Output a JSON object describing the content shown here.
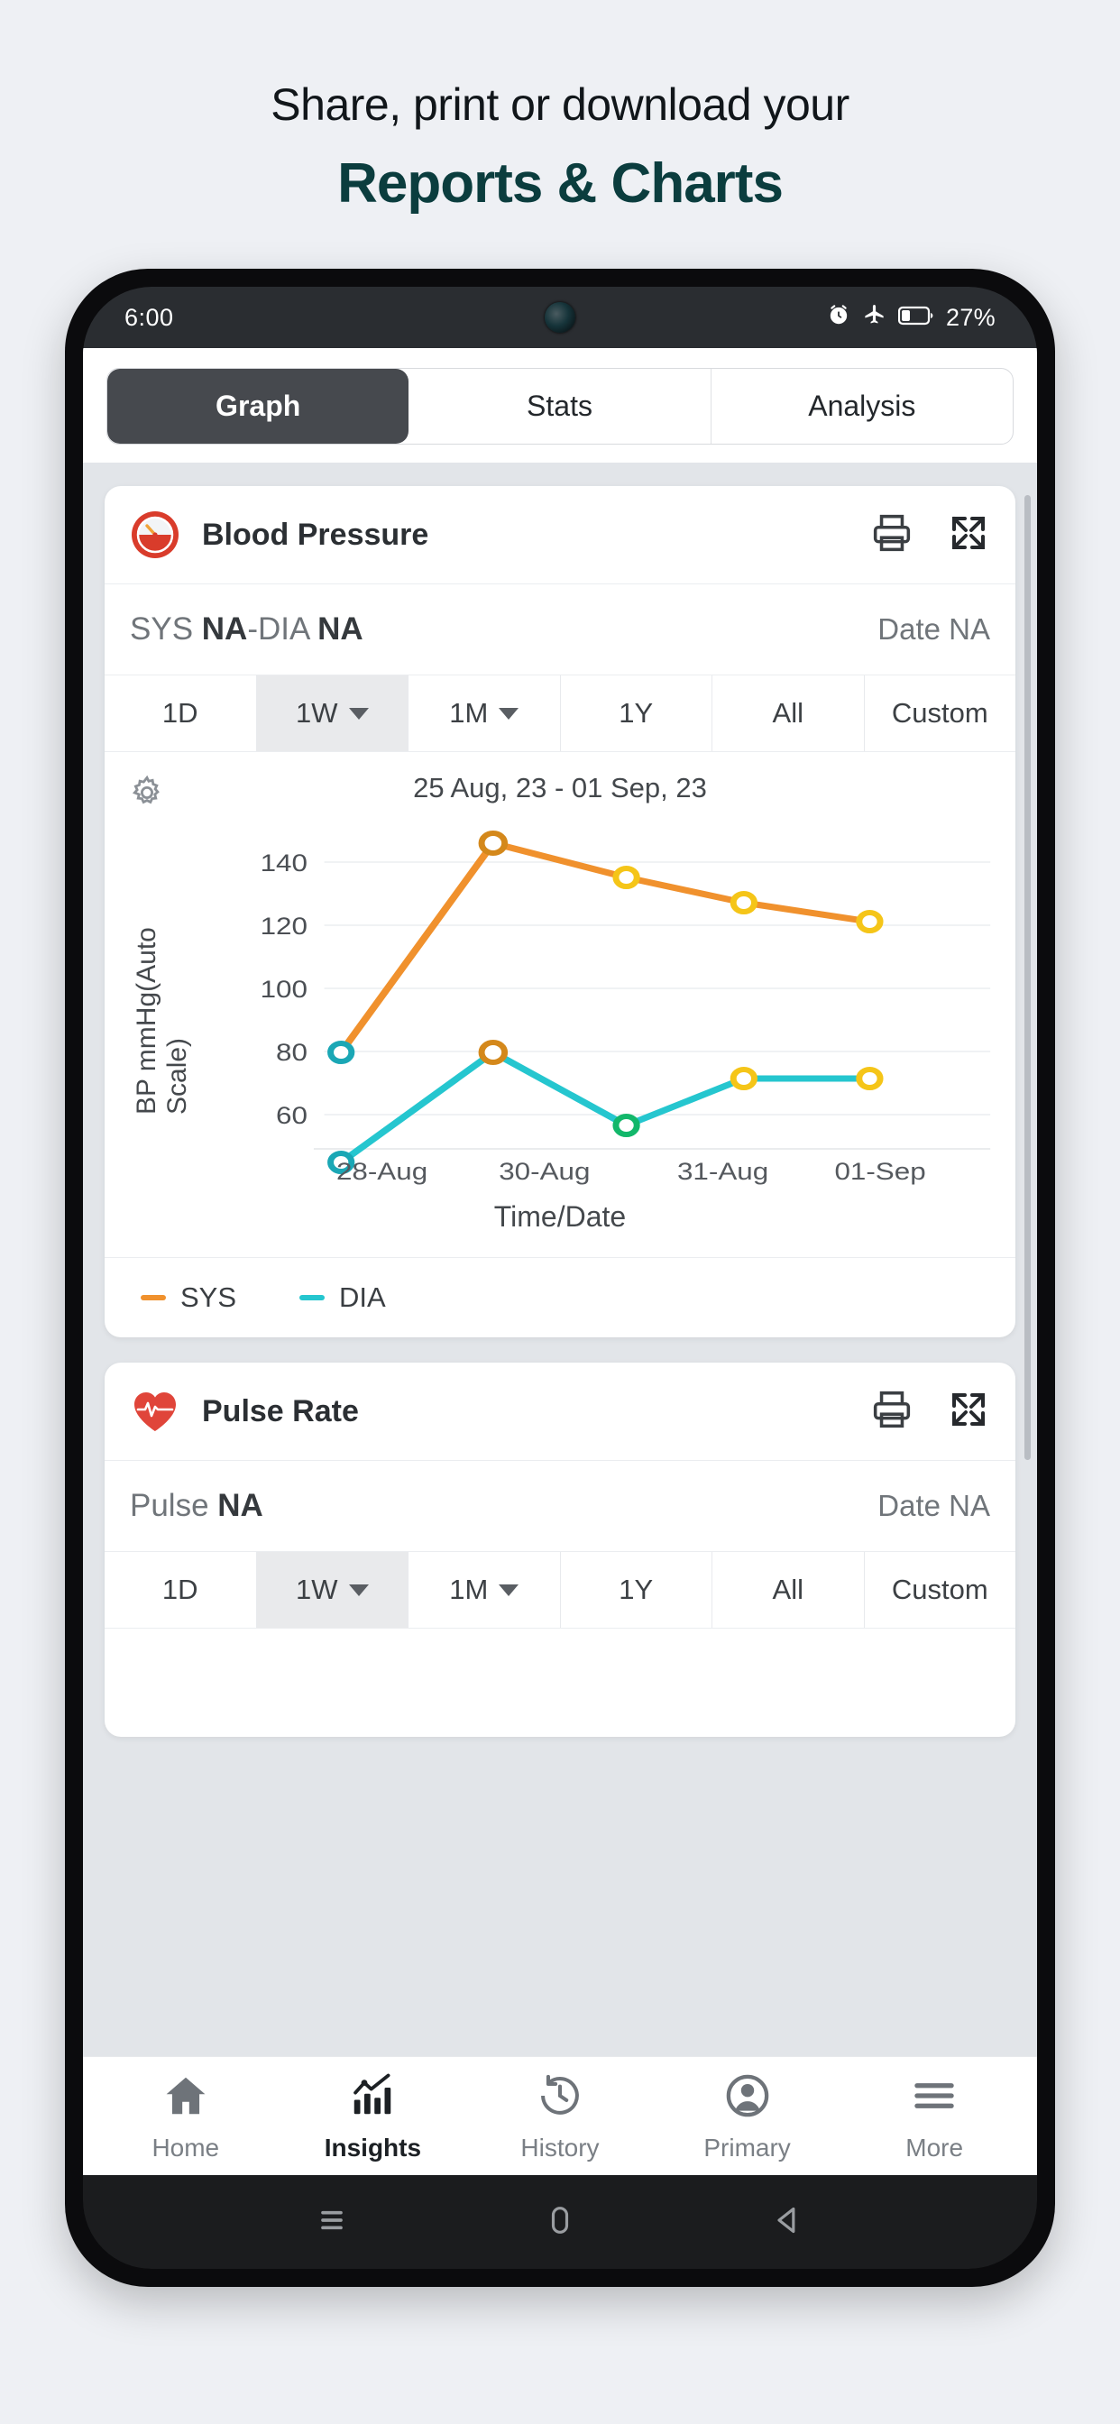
{
  "promo": {
    "line1": "Share, print or download your",
    "line2": "Reports & Charts",
    "accent_color": "#0b3d3e"
  },
  "statusbar": {
    "time": "6:00",
    "battery_percent": "27%",
    "icons": [
      "alarm-icon",
      "airplane-mode-icon",
      "battery-icon"
    ]
  },
  "tabs": [
    {
      "label": "Graph",
      "active": true
    },
    {
      "label": "Stats",
      "active": false
    },
    {
      "label": "Analysis",
      "active": false
    }
  ],
  "cards": [
    {
      "title": "Blood Pressure",
      "icon": "blood-pressure-gauge-icon",
      "actions": [
        "print-icon",
        "expand-icon"
      ],
      "summary_left_prefix": "SYS ",
      "summary_left_value1": "NA",
      "summary_left_mid": "-DIA ",
      "summary_left_value2": "NA",
      "summary_right": "Date NA",
      "periods": [
        {
          "label": "1D",
          "caret": false,
          "selected": false
        },
        {
          "label": "1W",
          "caret": true,
          "selected": true
        },
        {
          "label": "1M",
          "caret": true,
          "selected": false
        },
        {
          "label": "1Y",
          "caret": false,
          "selected": false
        },
        {
          "label": "All",
          "caret": false,
          "selected": false
        },
        {
          "label": "Custom",
          "caret": false,
          "selected": false
        }
      ]
    },
    {
      "title": "Pulse Rate",
      "icon": "heart-pulse-icon",
      "actions": [
        "print-icon",
        "expand-icon"
      ],
      "summary_left_prefix": "Pulse ",
      "summary_left_value1": "NA",
      "summary_right": "Date NA",
      "periods": [
        {
          "label": "1D",
          "caret": false,
          "selected": false
        },
        {
          "label": "1W",
          "caret": true,
          "selected": true
        },
        {
          "label": "1M",
          "caret": true,
          "selected": false
        },
        {
          "label": "1Y",
          "caret": false,
          "selected": false
        },
        {
          "label": "All",
          "caret": false,
          "selected": false
        },
        {
          "label": "Custom",
          "caret": false,
          "selected": false
        }
      ]
    }
  ],
  "chart_data": {
    "type": "line",
    "title": "25 Aug, 23 - 01 Sep, 23",
    "xlabel": "Time/Date",
    "ylabel": "BP mmHg(Auto Scale)",
    "x": [
      "28-Aug",
      "30-Aug",
      "31-Aug",
      "01-Sep"
    ],
    "xtick_labels": [
      "28-Aug",
      "30-Aug",
      "31-Aug",
      "01-Sep"
    ],
    "ytick_labels": [
      "140",
      "120",
      "100",
      "80",
      "60"
    ],
    "yticks": [
      140,
      120,
      100,
      80,
      60
    ],
    "ylim": [
      48,
      152
    ],
    "grid": true,
    "legend_position": "bottom-left",
    "series": [
      {
        "name": "SYS",
        "color": "#f0912d",
        "values": [
          88,
          146,
          135,
          127,
          121
        ],
        "marker_ring_colors": [
          "#1aa7b5",
          "#d4881b",
          "#f5c518",
          "#f5c518",
          "#f5c518"
        ]
      },
      {
        "name": "DIA",
        "color": "#25c6cf",
        "values": [
          53,
          88,
          65,
          80,
          80
        ],
        "marker_ring_colors": [
          "#1aa7b5",
          "#d4881b",
          "#12b76a",
          "#f5c518",
          "#f5c518"
        ]
      }
    ],
    "legend": [
      {
        "label": "SYS",
        "color": "#f0912d"
      },
      {
        "label": "DIA",
        "color": "#25c6cf"
      }
    ],
    "gear_icon": "chart-settings-gear-icon"
  },
  "bottomnav": [
    {
      "label": "Home",
      "icon": "home-icon",
      "active": false
    },
    {
      "label": "Insights",
      "icon": "insights-chart-icon",
      "active": true
    },
    {
      "label": "History",
      "icon": "history-clock-icon",
      "active": false
    },
    {
      "label": "Primary",
      "icon": "user-profile-icon",
      "active": false
    },
    {
      "label": "More",
      "icon": "hamburger-menu-icon",
      "active": false
    }
  ],
  "androidnav": [
    "recents-icon",
    "home-circle-icon",
    "back-triangle-icon"
  ]
}
